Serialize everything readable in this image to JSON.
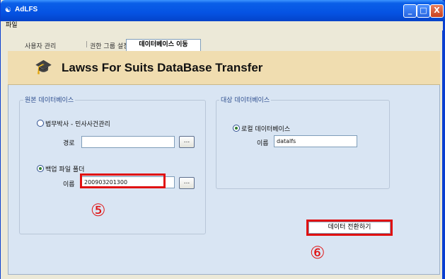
{
  "window": {
    "title": "AdLFS",
    "app_icon": "app-logo-icon",
    "controls": {
      "minimize": "_",
      "maximize": "□",
      "close": "X"
    }
  },
  "menu": {
    "file": "파일"
  },
  "tabs": {
    "user_mgmt": "사용자 관리",
    "separator": "|",
    "permission_group": "권한 그룹 설정",
    "db_migrate": "데이터베이스 이동"
  },
  "banner": {
    "icon": "graduation-cap-icon",
    "title": "Lawss For Suits  DataBase Transfer"
  },
  "source_db": {
    "legend": "원본 데이터베이스",
    "option_1": "법무박사 - 민사사건관리",
    "path_label": "경로",
    "path_value": "",
    "option_2": "백업 파일 폴더",
    "name_label": "이름",
    "name_value": "200903201300",
    "browse_label": "...",
    "selected": "option_2"
  },
  "target_db": {
    "legend": "대상 데이터베이스",
    "option_1": "로컬 데이터베이스",
    "name_label": "이름",
    "name_value": "datalfs",
    "selected": "option_1"
  },
  "actions": {
    "convert": "데이터 전환하기"
  },
  "annotations": {
    "step5": "⑤",
    "step6": "⑥"
  },
  "colors": {
    "highlight": "#E01010",
    "titlebar": "#0553E3",
    "panel": "#D9E5F3",
    "banner": "#F0DDB0"
  }
}
